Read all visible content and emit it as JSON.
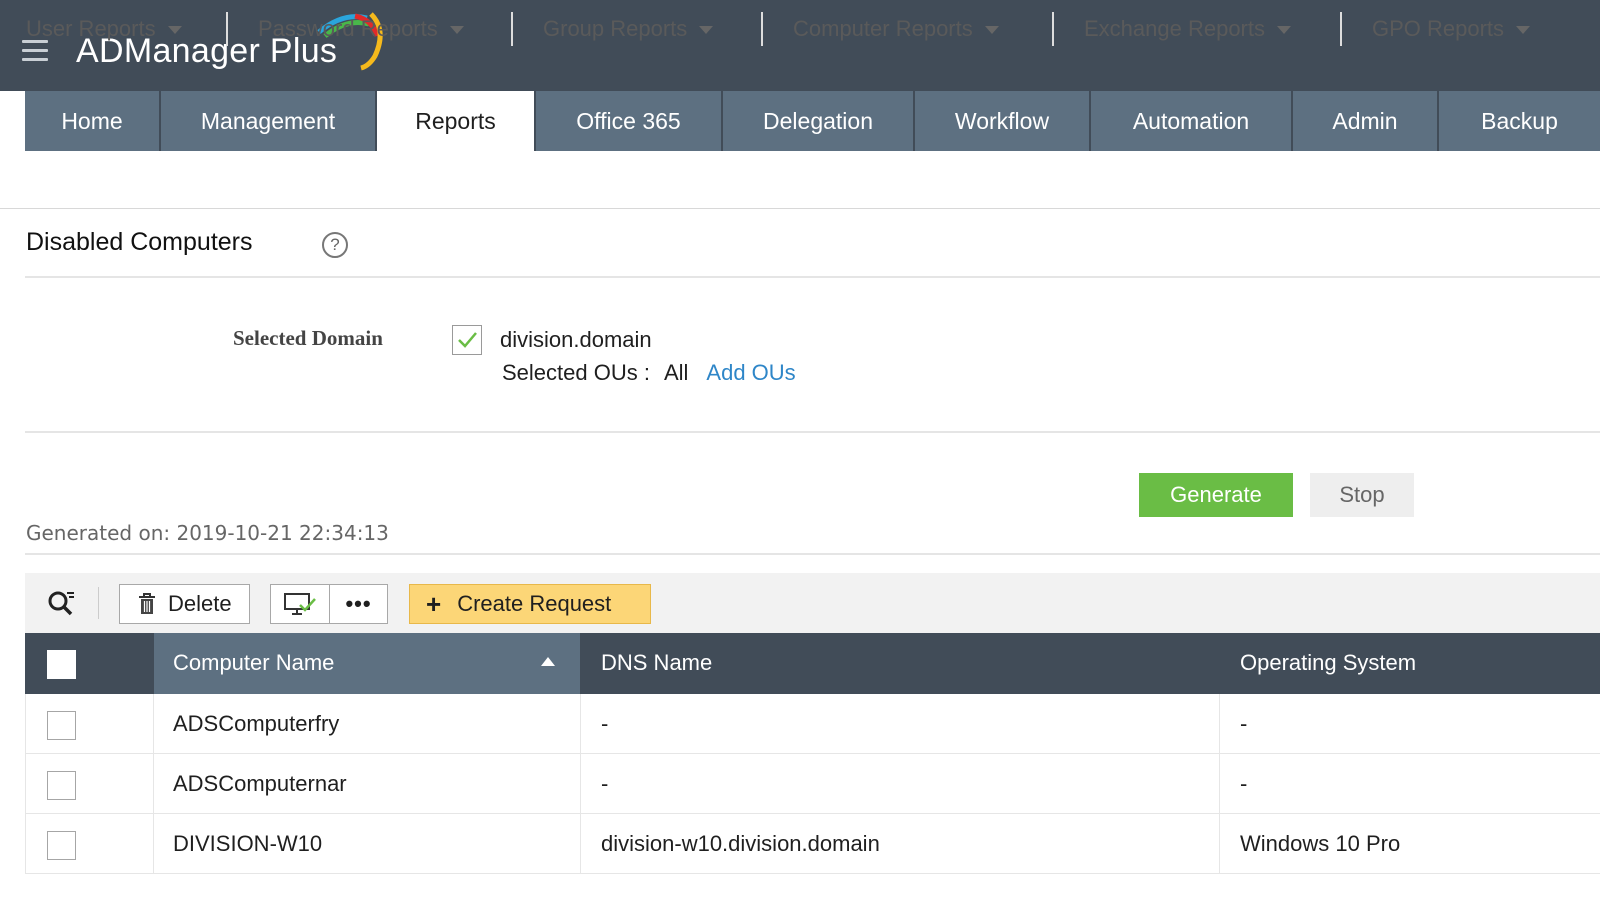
{
  "app": {
    "title": "ADManager Plus"
  },
  "main_tabs": [
    {
      "label": "Home"
    },
    {
      "label": "Management"
    },
    {
      "label": "Reports"
    },
    {
      "label": "Office 365"
    },
    {
      "label": "Delegation"
    },
    {
      "label": "Workflow"
    },
    {
      "label": "Automation"
    },
    {
      "label": "Admin"
    },
    {
      "label": "Backup"
    }
  ],
  "active_tab": "Reports",
  "sub_nav": [
    {
      "label": "User Reports"
    },
    {
      "label": "Password Reports"
    },
    {
      "label": "Group Reports"
    },
    {
      "label": "Computer Reports"
    },
    {
      "label": "Exchange Reports"
    },
    {
      "label": "GPO Reports"
    }
  ],
  "page": {
    "title": "Disabled Computers",
    "help_glyph": "?"
  },
  "domain": {
    "label": "Selected Domain",
    "value": "division.domain",
    "checked": true,
    "ous_label": "Selected OUs :",
    "ous_value": "All",
    "add_ous_link": "Add OUs"
  },
  "actions": {
    "generate_label": "Generate",
    "stop_label": "Stop"
  },
  "generated_on": "Generated on: 2019-10-21 22:34:13",
  "toolbar": {
    "delete_label": "Delete",
    "more_label": "•••",
    "create_request_label": "Create Request",
    "create_icon": "+"
  },
  "table": {
    "columns": [
      "Computer Name",
      "DNS Name",
      "Operating System"
    ],
    "sort": {
      "column": "Computer Name",
      "direction": "ascending"
    },
    "rows": [
      {
        "computer_name": "ADSComputerfry",
        "dns_name": "-",
        "os": "-"
      },
      {
        "computer_name": "ADSComputernar",
        "dns_name": "-",
        "os": "-"
      },
      {
        "computer_name": "DIVISION-W10",
        "dns_name": "division-w10.division.domain",
        "os": "Windows 10 Pro"
      }
    ]
  },
  "colors": {
    "header_bg": "#414c58",
    "tab_bg": "#5d7081",
    "generate_green": "#6abd45",
    "create_request_yellow": "#fcd677",
    "link_blue": "#2e86c8"
  },
  "icons": {
    "menu": "hamburger-icon",
    "help": "help-icon",
    "search": "search-filter-icon",
    "delete": "trash-icon",
    "computer": "computer-check-icon",
    "more": "more-icon"
  }
}
